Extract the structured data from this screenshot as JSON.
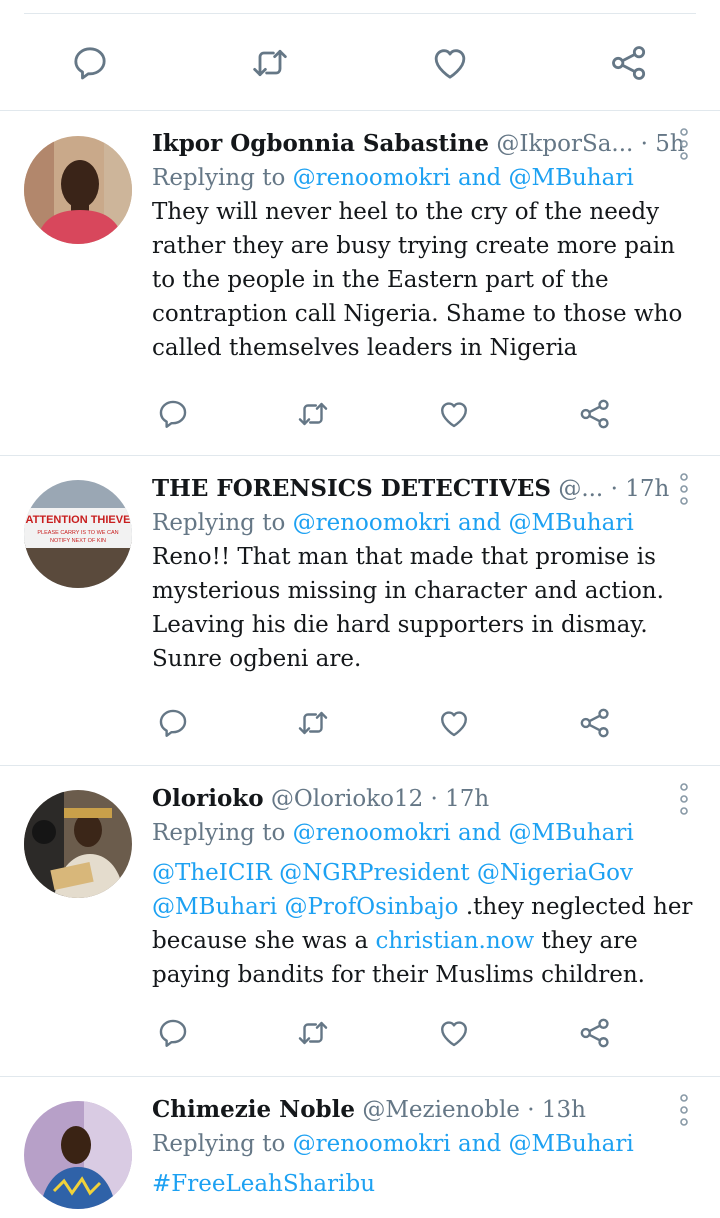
{
  "colors": {
    "link": "#1da1f2",
    "muted": "#657786",
    "text": "#14171a",
    "divider": "#e1e8ed"
  },
  "icons": [
    "reply-icon",
    "retweet-icon",
    "like-icon",
    "share-icon",
    "more-icon"
  ],
  "tweets": [
    {
      "name": "Ikpor Ogbonnia Sabastine",
      "handle": "@IkporSa...",
      "dot": "·",
      "time": "5h",
      "replying_prefix": "Replying to",
      "replying_to": "@renoomokri and @MBuhari",
      "text": "They will never heel to the cry of the needy rather they are busy trying create more pain to the people in the Eastern part of the contraption call Nigeria. Shame to those who called themselves leaders in Nigeria"
    },
    {
      "name": "THE FORENSICS DETECTIVES",
      "handle": "@...",
      "dot": "·",
      "time": "17h",
      "replying_prefix": "Replying to",
      "replying_to": "@renoomokri and @MBuhari",
      "text": "Reno!! That man that made that promise is mysterious missing in character and action. Leaving his die hard supporters in dismay. Sunre ogbeni are.",
      "avatar_sign_line1": "ATTENTION THIEVE",
      "avatar_sign_line2": "PLEASE CARRY IS TO WE CAN",
      "avatar_sign_line3": "NOTIFY NEXT OF KIN"
    },
    {
      "name": "Olorioko",
      "handle": "@Olorioko12",
      "dot": "·",
      "time": "17h",
      "replying_prefix": "Replying to",
      "replying_to": "@renoomokri and @MBuhari",
      "mentions_line1": "@TheICIR @NGRPresident @NigeriaGov",
      "mentions_line2": "@MBuhari @ProfOsinbajo",
      "text_after_mentions": " .they neglected her because she was a ",
      "link": "christian.now",
      "text_end": " they are paying bandits for their Muslims children."
    },
    {
      "name": "Chimezie Noble",
      "handle": "@Mezienoble",
      "dot": "·",
      "time": "13h",
      "replying_prefix": "Replying to",
      "replying_to": "@renoomokri and @MBuhari",
      "hashtag": "#FreeLeahSharibu"
    }
  ]
}
